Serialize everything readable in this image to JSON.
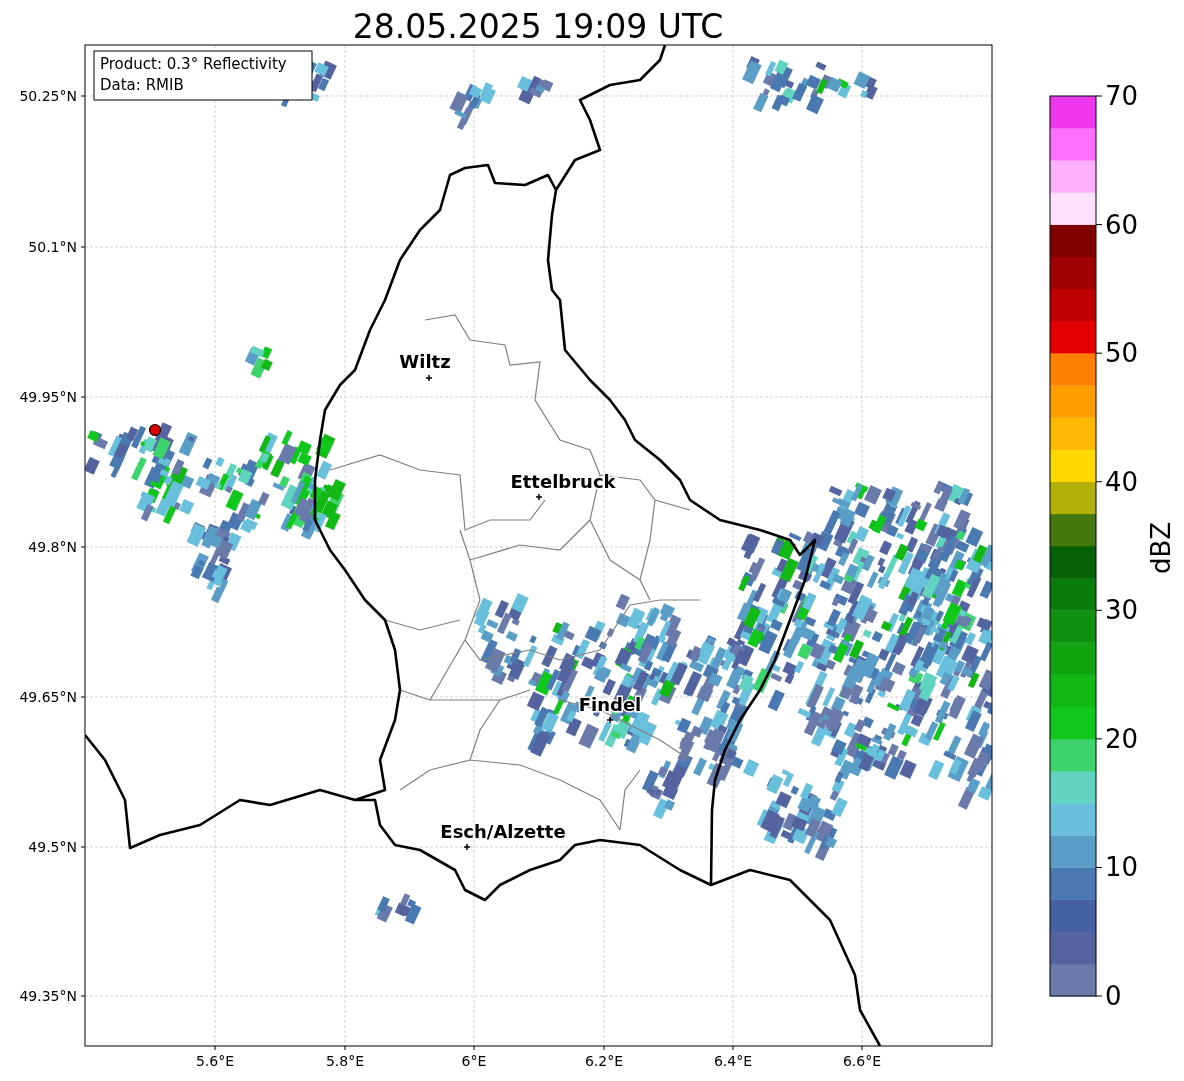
{
  "title": "28.05.2025 19:09 UTC",
  "legend": [
    "Product: 0.3° Reflectivity",
    "Data: RMIB"
  ],
  "y_ticks": [
    "50.25°N",
    "50.1°N",
    "49.95°N",
    "49.8°N",
    "49.65°N",
    "49.5°N",
    "49.35°N"
  ],
  "x_ticks": [
    "5.6°E",
    "5.8°E",
    "6°E",
    "6.2°E",
    "6.4°E",
    "6.6°E"
  ],
  "cities": [
    {
      "name": "Wiltz"
    },
    {
      "name": "Ettelbruck"
    },
    {
      "name": "Findel"
    },
    {
      "name": "Esch/Alzette"
    }
  ],
  "colorbar": {
    "label": "dBZ",
    "ticks": [
      "70",
      "60",
      "50",
      "40",
      "30",
      "20",
      "10",
      "0"
    ],
    "bins": [
      {
        "color": "#6a7aab"
      },
      {
        "color": "#5464a0"
      },
      {
        "color": "#4660a4"
      },
      {
        "color": "#4a78b0"
      },
      {
        "color": "#5a9ec8"
      },
      {
        "color": "#68c0dc"
      },
      {
        "color": "#60d4c0"
      },
      {
        "color": "#3ed46c"
      },
      {
        "color": "#10c81c"
      },
      {
        "color": "#12b814"
      },
      {
        "color": "#10a410"
      },
      {
        "color": "#0e9010"
      },
      {
        "color": "#0a7c0c"
      },
      {
        "color": "#066008"
      },
      {
        "color": "#467810"
      },
      {
        "color": "#b0b008"
      },
      {
        "color": "#ffd800"
      },
      {
        "color": "#ffb800"
      },
      {
        "color": "#ff9c00"
      },
      {
        "color": "#ff8000"
      },
      {
        "color": "#e40000"
      },
      {
        "color": "#c00000"
      },
      {
        "color": "#a00000"
      },
      {
        "color": "#800000"
      },
      {
        "color": "#ffe0ff"
      },
      {
        "color": "#ffb0ff"
      },
      {
        "color": "#ff70ff"
      },
      {
        "color": "#ee38ee"
      }
    ]
  }
}
